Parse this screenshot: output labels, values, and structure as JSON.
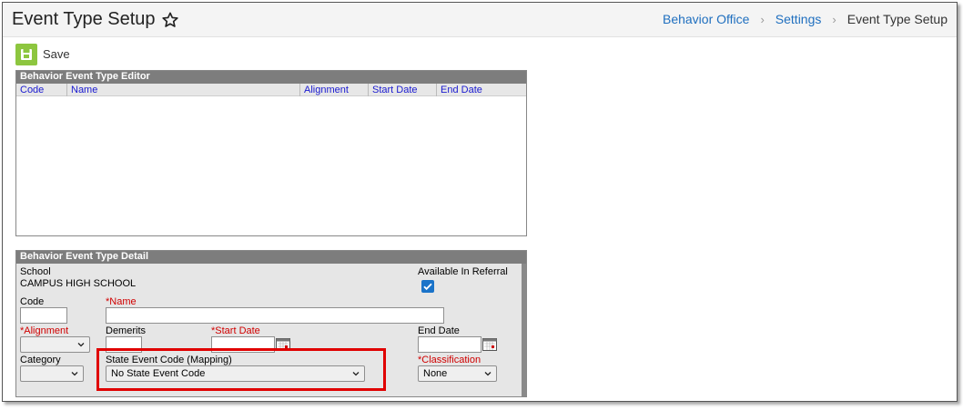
{
  "header": {
    "title": "Event Type Setup",
    "breadcrumb": [
      "Behavior Office",
      "Settings",
      "Event Type Setup"
    ]
  },
  "toolbar": {
    "save_label": "Save"
  },
  "editor": {
    "title": "Behavior Event Type Editor",
    "columns": [
      "Code",
      "Name",
      "Alignment",
      "Start Date",
      "End Date"
    ]
  },
  "detail": {
    "title": "Behavior Event Type Detail",
    "school_label": "School",
    "school_value": "CAMPUS HIGH SCHOOL",
    "available_label": "Available In Referral",
    "code_label": "Code",
    "name_label": "*Name",
    "alignment_label": "*Alignment",
    "demerits_label": "Demerits",
    "start_date_label": "*Start Date",
    "end_date_label": "End Date",
    "category_label": "Category",
    "state_code_label": "State Event Code (Mapping)",
    "state_code_value": "No State Event Code",
    "classification_label": "*Classification",
    "classification_value": "None"
  },
  "colors": {
    "accent_green": "#8dc63f",
    "link_blue": "#1f6fbf",
    "required_red": "#d00000",
    "highlight_red": "#e00000"
  }
}
